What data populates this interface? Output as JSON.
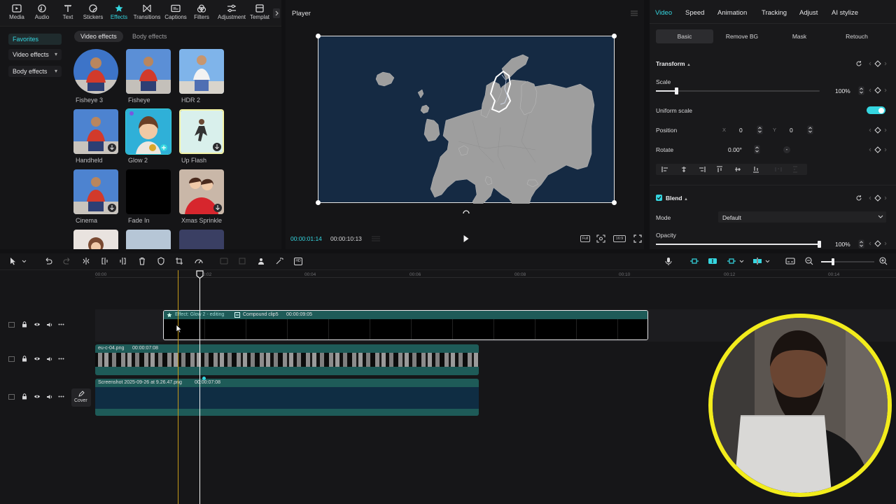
{
  "toolbar": {
    "items": [
      {
        "label": "Media",
        "icon": "media-icon"
      },
      {
        "label": "Audio",
        "icon": "audio-icon"
      },
      {
        "label": "Text",
        "icon": "text-icon"
      },
      {
        "label": "Stickers",
        "icon": "stickers-icon"
      },
      {
        "label": "Effects",
        "icon": "effects-icon",
        "active": true
      },
      {
        "label": "Transitions",
        "icon": "transitions-icon"
      },
      {
        "label": "Captions",
        "icon": "captions-icon"
      },
      {
        "label": "Filters",
        "icon": "filters-icon"
      },
      {
        "label": "Adjustment",
        "icon": "adjustment-icon"
      },
      {
        "label": "Templat",
        "icon": "templates-icon"
      }
    ]
  },
  "left_nav": {
    "favorites": "Favorites",
    "video_effects": "Video effects",
    "body_effects": "Body effects"
  },
  "effects_tabs": {
    "video_effects": "Video effects",
    "body_effects": "Body effects"
  },
  "effects": [
    {
      "label": "Fisheye 3"
    },
    {
      "label": "Fisheye"
    },
    {
      "label": "HDR 2"
    },
    {
      "label": "Handheld"
    },
    {
      "label": "Glow 2"
    },
    {
      "label": "Up Flash"
    },
    {
      "label": "Cinema"
    },
    {
      "label": "Fade In"
    },
    {
      "label": "Xmas Sprinkle"
    }
  ],
  "player": {
    "title": "Player",
    "current_time": "00:00:01:14",
    "total_time": "00:00:10:13",
    "full_label": "Full",
    "ratio_label": "16:9"
  },
  "right_panel": {
    "tabs": [
      "Video",
      "Speed",
      "Animation",
      "Tracking",
      "Adjust",
      "AI stylize"
    ],
    "subtabs": [
      "Basic",
      "Remove BG",
      "Mask",
      "Retouch"
    ],
    "transform_title": "Transform",
    "scale_label": "Scale",
    "scale_value": "100%",
    "scale_level": 0.13,
    "uniform_scale_label": "Uniform scale",
    "uniform_scale_on": true,
    "position_label": "Position",
    "pos_x_label": "X",
    "pos_x": "0",
    "pos_y_label": "Y",
    "pos_y": "0",
    "rotate_label": "Rotate",
    "rotate_value": "0.00°",
    "blend_title": "Blend",
    "mode_label": "Mode",
    "mode_value": "Default",
    "opacity_label": "Opacity",
    "opacity_value": "100%",
    "opacity_level": 1.0
  },
  "timeline": {
    "ruler": [
      "00:00",
      "00:02",
      "00:04",
      "00:06",
      "00:08",
      "00:10",
      "00:12",
      "00:14"
    ],
    "effect_clip": {
      "label": "Effect: Glow 2 - editing",
      "compound": "Compound clip5",
      "duration": "00:00:09:05"
    },
    "image_clip": {
      "name": "eu-c-04.png",
      "duration": "00:00:07:08"
    },
    "screenshot_clip": {
      "name": "Screenshot 2025-09-26 at 9.26.47.png",
      "duration": "00:00:07:08"
    },
    "cover_label": "Cover"
  },
  "colors": {
    "accent": "#35d6e0",
    "clip_teal": "#1e5b58",
    "ring_yellow": "#f2ec1c"
  }
}
